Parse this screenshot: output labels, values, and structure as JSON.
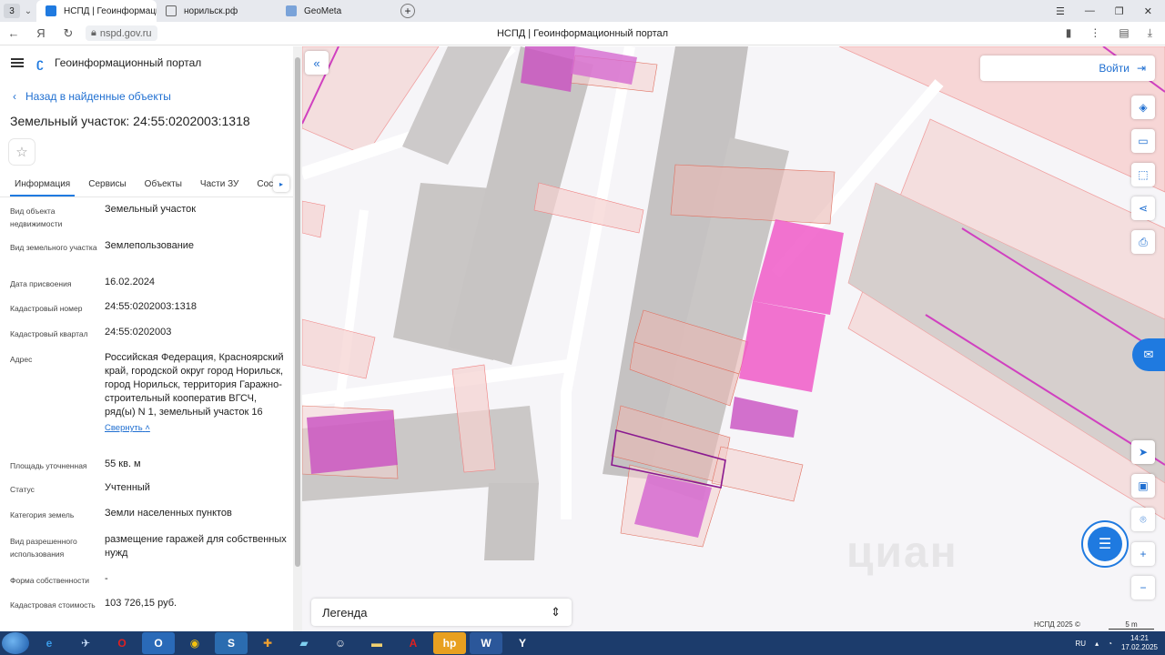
{
  "browser": {
    "tab_count": "3",
    "tabs": [
      {
        "label": "НСПД | Геоинформацио"
      },
      {
        "label": "норильск.рф"
      },
      {
        "label": "GeoMeta"
      }
    ],
    "url": "nspd.gov.ru",
    "page_title": "НСПД | Геоинформационный портал"
  },
  "panel": {
    "app_title": "Геоинформационный портал",
    "back_label": "Назад в найденные объекты",
    "object_title": "Земельный участок: 24:55:0202003:1318",
    "tabs": [
      "Информация",
      "Сервисы",
      "Объекты",
      "Части ЗУ",
      "Соста"
    ],
    "rows": [
      {
        "label": "Вид объекта недвижимости",
        "value": "Земельный участок"
      },
      {
        "label": "Вид земельного участка",
        "value": "Землепользование"
      },
      {
        "label": "Дата присвоения",
        "value": "16.02.2024"
      },
      {
        "label": "Кадастровый номер",
        "value": "24:55:0202003:1318"
      },
      {
        "label": "Кадастровый квартал",
        "value": "24:55:0202003"
      },
      {
        "label": "Адрес",
        "value": "Российская Федерация, Красноярский край, городской округ город Норильск, город Норильск, территория Гаражно-строительный кооператив ВГСЧ, ряд(ы) N 1, земельный участок 16"
      },
      {
        "label": "Площадь уточненная",
        "value": "55 кв. м"
      },
      {
        "label": "Статус",
        "value": "Учтенный"
      },
      {
        "label": "Категория земель",
        "value": "Земли населенных пунктов"
      },
      {
        "label": "Вид разрешенного использования",
        "value": "размещение гаражей для собственных нужд"
      },
      {
        "label": "Форма собственности",
        "value": "-"
      },
      {
        "label": "Кадастровая стоимость",
        "value": "103 726,15 руб."
      }
    ],
    "collapse_label": "Свернуть"
  },
  "map": {
    "login_label": "Войти",
    "legend_label": "Легенда",
    "copyright": "НСПД 2025 ©",
    "scale_label": "5 m",
    "watermark": "циан"
  },
  "taskbar": {
    "lang": "RU",
    "time": "14:21",
    "date": "17.02.2025"
  }
}
